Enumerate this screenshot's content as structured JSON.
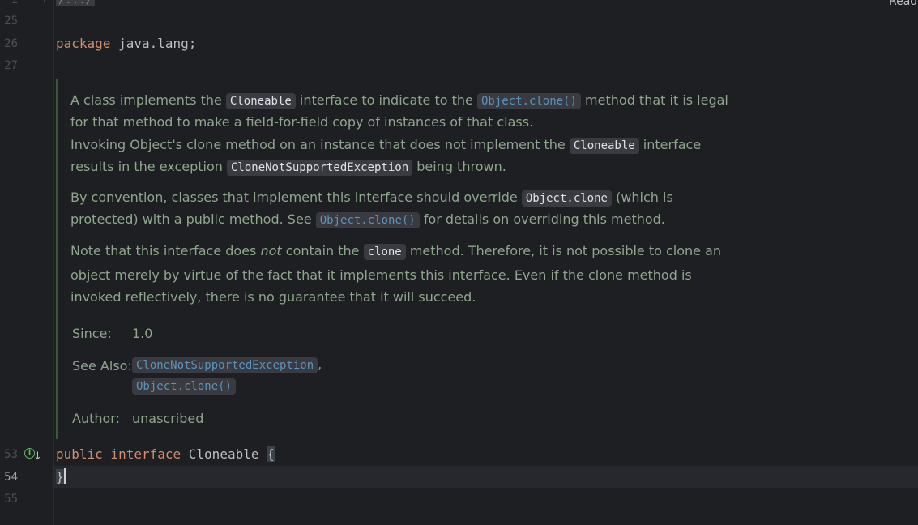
{
  "editor": {
    "reader_mode_label": "Read",
    "folded_header": {
      "line_number": "1",
      "text": "/.../"
    },
    "lines": [
      {
        "number": "25",
        "code": ""
      },
      {
        "number": "26",
        "keyword": "package",
        "rest": " java.lang;"
      },
      {
        "number": "27",
        "code": ""
      },
      {
        "number": "53",
        "keyword1": "public",
        "keyword2": "interface",
        "name": "Cloneable",
        "brace": "{"
      },
      {
        "number": "54",
        "brace": "}"
      },
      {
        "number": "55",
        "code": ""
      }
    ],
    "gutter_icon": "implemented-interface-icon"
  },
  "javadoc": {
    "p1": {
      "t1": "A class implements the ",
      "c1": "Cloneable",
      "t2": " interface to indicate to the ",
      "l1": "Object.clone()",
      "t3": " method that it is legal for that method to make a field-for-field copy of instances of that class."
    },
    "p2": {
      "t1": "Invoking Object's clone method on an instance that does not implement the ",
      "c1": "Cloneable",
      "t2": " interface results in the exception ",
      "c2": "CloneNotSupportedException",
      "t3": " being thrown."
    },
    "p3": {
      "t1": "By convention, classes that implement this interface should override ",
      "c1": "Object.clone",
      "t2": " (which is protected) with a public method. See ",
      "l1": "Object.clone()",
      "t3": " for details on overriding this method."
    },
    "p4": {
      "t1": "Note that this interface does ",
      "em": "not",
      "t2": " contain the ",
      "c1": "clone",
      "t3": " method. Therefore, it is not possible to clone an object merely by virtue of the fact that it implements this interface. Even if the clone method is invoked reflectively, there is no guarantee that it will succeed."
    },
    "tags": {
      "since_label": "Since:",
      "since_value": "1.0",
      "see_also_label": "See Also:",
      "see_also_links": [
        "CloneNotSupportedException",
        "Object.clone()"
      ],
      "see_also_sep": ",",
      "author_label": "Author:",
      "author_value": "unascribed"
    }
  }
}
